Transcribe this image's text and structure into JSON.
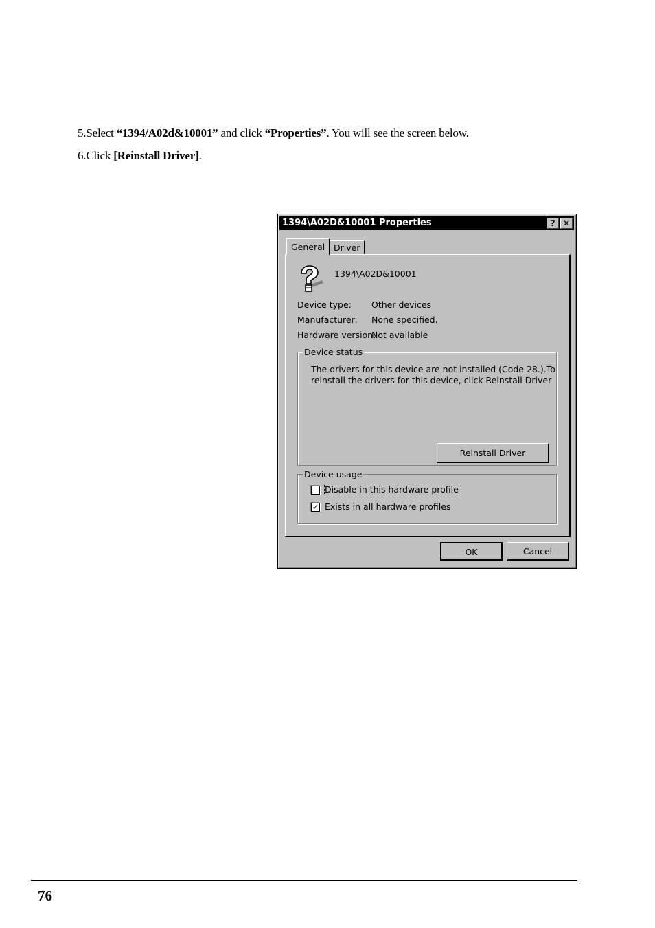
{
  "instructions": {
    "step5": {
      "prefix": "5.Select ",
      "device": "“1394/A02d&10001”",
      "middle": " and click ",
      "action": "“Properties”",
      "suffix": ". You will see the screen below."
    },
    "step6": {
      "prefix": "6.Click ",
      "action": "[Reinstall Driver]",
      "suffix": "."
    }
  },
  "dialog": {
    "title": "1394\\A02D&10001 Properties",
    "help_glyph": "?",
    "close_glyph": "✕",
    "tabs": [
      "General",
      "Driver"
    ],
    "active_tab": "General",
    "device_name": "1394\\A02D&10001",
    "device_icon": "question-mark-device-icon",
    "properties": [
      {
        "label": "Device type:",
        "value": "Other devices"
      },
      {
        "label": "Manufacturer:",
        "value": "None specified."
      },
      {
        "label": "Hardware version:",
        "value": "Not available"
      }
    ],
    "device_status": {
      "legend": "Device status",
      "lines": [
        "The drivers for this device are not installed  (Code 28.).To",
        "reinstall the drivers for this device, click Reinstall Driver"
      ],
      "reinstall_button": "Reinstall Driver"
    },
    "device_usage": {
      "legend": "Device usage",
      "options": [
        {
          "label": "Disable in this hardware profile",
          "checked": false
        },
        {
          "label": "Exists in all hardware profiles",
          "checked": true
        }
      ]
    },
    "ok_button": "OK",
    "cancel_button": "Cancel"
  },
  "page_number": "76"
}
